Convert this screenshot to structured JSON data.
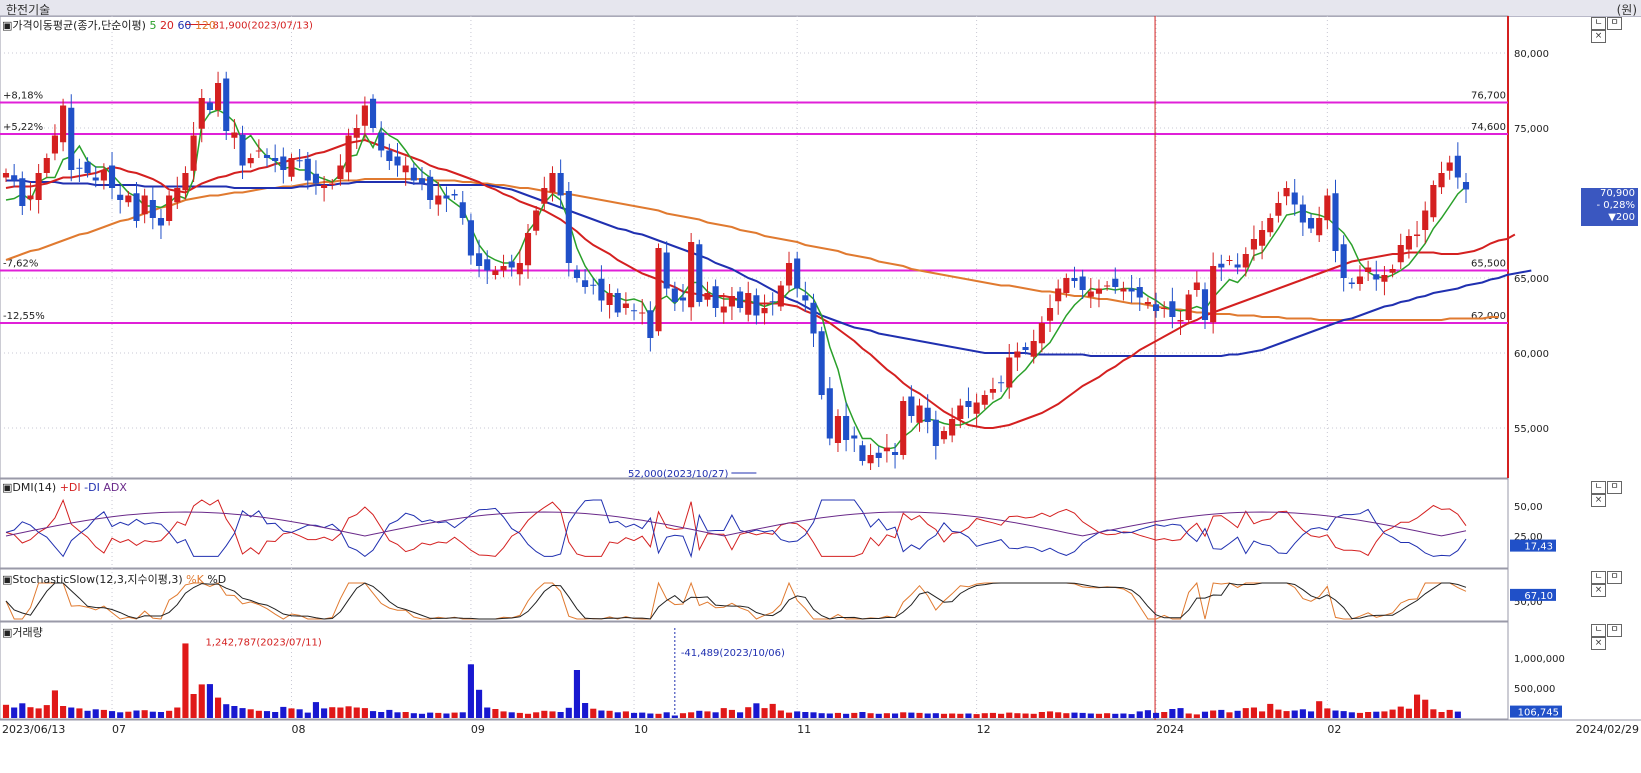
{
  "window": {
    "title": "한전기술",
    "unit_label": "(원)"
  },
  "panels": {
    "price": {
      "label_prefix": "가격이동평균(종가,단순이평)",
      "ma_labels": [
        "5",
        "20",
        "60",
        "120"
      ],
      "ma_colors": [
        "#2aa02a",
        "#d42020",
        "#2030b0",
        "#e07a30"
      ]
    },
    "dmi": {
      "label_prefix": "DMI(14)",
      "plus_di": "+DI",
      "minus_di": "-DI",
      "adx": "ADX",
      "value_label": "17,43"
    },
    "stoch": {
      "label_prefix": "StochasticSlow(12,3,지수이평,3)",
      "k": "%K",
      "d": "%D",
      "value_label": "67,10"
    },
    "volume": {
      "label_prefix": "거래량",
      "value_label": "106,745"
    }
  },
  "current_price": {
    "price": "70,900",
    "change_pct": "- 0,28%",
    "change": "▼200"
  },
  "controls": [
    "ㄴ",
    "ㅁ",
    "×"
  ],
  "chart_data": {
    "type": "candlestick",
    "title": "한전기술",
    "y_ticks": [
      "80,000",
      "75,000",
      "65,000",
      "60,000",
      "55,000"
    ],
    "y_range": [
      51800,
      82200
    ],
    "hlines": [
      {
        "price": 76700,
        "left_label": "+8,18%",
        "right_label": "76,700"
      },
      {
        "price": 74600,
        "left_label": "+5,22%",
        "right_label": "74,600"
      },
      {
        "price": 65500,
        "left_label": "-7,62%",
        "right_label": "65,500"
      },
      {
        "price": 62000,
        "left_label": "-12,55%",
        "right_label": "62,000"
      }
    ],
    "annotations": [
      {
        "text": "81,900(2023/07/13)",
        "price": 81900
      },
      {
        "text": "52,000(2023/10/27)",
        "price": 52000
      }
    ],
    "dates": [
      "2023/06/13",
      "2023/06/14",
      "2023/06/15",
      "2023/06/16",
      "2023/06/19",
      "2023/06/20",
      "2023/06/21",
      "2023/06/22",
      "2023/06/23",
      "2023/06/26",
      "2023/06/27",
      "2023/06/28",
      "2023/06/29",
      "2023/06/30",
      "2023/07/03",
      "2023/07/04",
      "2023/07/05",
      "2023/07/06",
      "2023/07/07",
      "2023/07/10",
      "2023/07/11",
      "2023/07/12",
      "2023/07/13",
      "2023/07/14",
      "2023/07/17",
      "2023/07/18",
      "2023/07/19",
      "2023/07/20",
      "2023/07/21",
      "2023/07/24",
      "2023/07/25",
      "2023/07/26",
      "2023/07/27",
      "2023/07/28",
      "2023/07/31",
      "2023/08/01",
      "2023/08/02",
      "2023/08/03",
      "2023/08/04",
      "2023/08/07",
      "2023/08/08",
      "2023/08/09",
      "2023/08/10",
      "2023/08/11",
      "2023/08/14",
      "2023/08/16",
      "2023/08/17",
      "2023/08/18",
      "2023/08/21",
      "2023/08/22",
      "2023/08/23",
      "2023/08/24",
      "2023/08/25",
      "2023/08/28",
      "2023/08/29",
      "2023/08/30",
      "2023/08/31",
      "2023/09/01",
      "2023/09/04",
      "2023/09/05",
      "2023/09/06",
      "2023/09/07",
      "2023/09/08",
      "2023/09/11",
      "2023/09/12",
      "2023/09/13",
      "2023/09/14",
      "2023/09/15",
      "2023/09/18",
      "2023/09/19",
      "2023/09/20",
      "2023/09/21",
      "2023/09/22",
      "2023/09/25",
      "2023/09/26",
      "2023/09/27",
      "2023/10/04",
      "2023/10/05",
      "2023/10/06",
      "2023/10/10",
      "2023/10/11",
      "2023/10/12",
      "2023/10/13",
      "2023/10/16",
      "2023/10/17",
      "2023/10/18",
      "2023/10/19",
      "2023/10/20",
      "2023/10/23",
      "2023/10/24",
      "2023/10/25",
      "2023/10/26",
      "2023/10/27",
      "2023/10/30",
      "2023/10/31",
      "2023/11/01",
      "2023/11/02",
      "2023/11/03",
      "2023/11/06",
      "2023/11/07",
      "2023/11/08",
      "2023/11/09",
      "2023/11/10",
      "2023/11/13",
      "2023/11/14",
      "2023/11/15",
      "2023/11/16",
      "2023/11/17",
      "2023/11/20",
      "2023/11/21",
      "2023/11/22",
      "2023/11/23",
      "2023/11/24",
      "2023/11/27",
      "2023/11/28",
      "2023/11/29",
      "2023/11/30",
      "2023/12/01",
      "2023/12/04",
      "2023/12/05",
      "2023/12/06",
      "2023/12/07",
      "2023/12/08",
      "2023/12/11",
      "2023/12/12",
      "2023/12/13",
      "2023/12/14",
      "2023/12/15",
      "2023/12/18",
      "2023/12/19",
      "2023/12/20",
      "2023/12/21",
      "2023/12/22",
      "2023/12/26",
      "2023/12/27",
      "2023/12/28",
      "2024/01/02",
      "2024/01/03",
      "2024/01/04",
      "2024/01/05",
      "2024/01/08",
      "2024/01/09",
      "2024/01/10",
      "2024/01/11",
      "2024/01/12",
      "2024/01/15",
      "2024/01/16",
      "2024/01/17",
      "2024/01/18",
      "2024/01/19",
      "2024/01/22",
      "2024/01/23",
      "2024/01/24",
      "2024/01/25",
      "2024/01/26",
      "2024/01/29",
      "2024/01/30",
      "2024/01/31",
      "2024/02/01",
      "2024/02/02",
      "2024/02/05",
      "2024/02/06",
      "2024/02/07",
      "2024/02/08",
      "2024/02/13",
      "2024/02/14",
      "2024/02/15",
      "2024/02/16",
      "2024/02/19",
      "2024/02/20",
      "2024/02/21",
      "2024/02/22",
      "2024/02/23",
      "2024/02/26",
      "2024/02/27",
      "2024/02/28",
      "2024/02/29"
    ],
    "close": [
      72000,
      71500,
      69800,
      70500,
      72000,
      73000,
      74500,
      76500,
      72200,
      72300,
      72000,
      71500,
      72200,
      71000,
      70200,
      70500,
      68800,
      70500,
      69000,
      68500,
      70500,
      71000,
      72000,
      74500,
      77000,
      76200,
      78000,
      74800,
      74700,
      72500,
      73000,
      73500,
      73000,
      72800,
      72200,
      73000,
      72800,
      71500,
      71300,
      71200,
      71300,
      72500,
      74500,
      75000,
      76500,
      75000,
      73500,
      72800,
      72500,
      72500,
      71500,
      71300,
      70200,
      70500,
      70300,
      70500,
      69000,
      66500,
      65800,
      65500,
      65500,
      65800,
      65700,
      66000,
      68000,
      69500,
      71000,
      72000,
      70500,
      66000,
      65000,
      64400,
      64500,
      63500,
      64000,
      62700,
      63300,
      62800,
      62700,
      61000,
      67000,
      64300,
      63400,
      63500,
      67400,
      63400,
      64000,
      63000,
      63100,
      63800,
      63000,
      64000,
      62500,
      63000,
      63400,
      64500,
      66000,
      64300,
      63500,
      61300,
      57200,
      54300,
      55800,
      54200,
      54300,
      52800,
      53200,
      53000,
      53700,
      53200,
      56800,
      55800,
      56500,
      55400,
      53800,
      54800,
      55600,
      56500,
      56400,
      56700,
      57200,
      57600,
      58000,
      59700,
      60100,
      60200,
      60800,
      62000,
      63000,
      64300,
      65000,
      64800,
      64200,
      64100,
      64300,
      64500,
      64400,
      64300,
      64100,
      63700,
      63400,
      62800,
      63000,
      62400,
      62200,
      63900,
      64700,
      62200,
      65800,
      65700,
      66200,
      65700,
      66600,
      67600,
      68200,
      69000,
      70000,
      71000,
      69900,
      68700,
      68300,
      69000,
      70500,
      66800,
      65000,
      64600,
      65100,
      65700,
      64900,
      65200,
      65600,
      67200,
      67800,
      67900,
      69500,
      71200,
      72000,
      72700,
      71700,
      70900
    ],
    "volume": [
      220000,
      175000,
      245000,
      180000,
      160000,
      215000,
      460000,
      200000,
      175000,
      160000,
      120000,
      145000,
      135000,
      115000,
      95000,
      105000,
      125000,
      130000,
      105000,
      100000,
      120000,
      175000,
      1242787,
      400000,
      560000,
      565000,
      340000,
      230000,
      200000,
      165000,
      145000,
      120000,
      115000,
      100000,
      185000,
      160000,
      145000,
      90000,
      265000,
      160000,
      180000,
      175000,
      195000,
      175000,
      165000,
      115000,
      100000,
      135000,
      95000,
      100000,
      80000,
      70000,
      90000,
      85000,
      75000,
      90000,
      95000,
      895000,
      470000,
      175000,
      150000,
      110000,
      95000,
      85000,
      70000,
      95000,
      120000,
      110000,
      100000,
      170000,
      800000,
      250000,
      155000,
      125000,
      120000,
      95000,
      110000,
      85000,
      90000,
      75000,
      70000,
      95000,
      41489,
      80000,
      95000,
      120000,
      110000,
      95000,
      165000,
      135000,
      95000,
      180000,
      245000,
      165000,
      235000,
      125000,
      90000,
      110000,
      100000,
      95000,
      80000,
      75000,
      85000,
      70000,
      85000,
      100000,
      80000,
      70000,
      80000,
      75000,
      95000,
      90000,
      85000,
      75000,
      80000,
      70000,
      75000,
      70000,
      75000,
      65000,
      80000,
      85000,
      70000,
      90000,
      80000,
      75000,
      70000,
      100000,
      110000,
      95000,
      80000,
      90000,
      85000,
      75000,
      70000,
      80000,
      70000,
      75000,
      65000,
      110000,
      130000,
      85000,
      100000,
      150000,
      165000,
      75000,
      60000,
      105000,
      125000,
      135000,
      95000,
      120000,
      165000,
      175000,
      110000,
      235000,
      140000,
      115000,
      125000,
      145000,
      110000,
      280000,
      160000,
      125000,
      115000,
      95000,
      85000,
      100000,
      105000,
      110000,
      140000,
      190000,
      155000,
      390000,
      305000,
      145000,
      100000,
      135000,
      106745
    ],
    "ma5": [
      70200,
      70300,
      70600,
      70200,
      71400,
      71700,
      71700,
      72900,
      73100,
      73800,
      72800,
      72400,
      72400,
      71900,
      71300,
      70700,
      70400,
      69800,
      69800,
      69700,
      70000,
      70500,
      70300,
      71600,
      75200,
      76000,
      76200,
      75900,
      75400,
      74100,
      74500,
      73700,
      73100,
      72800,
      72300,
      72400,
      72200,
      72200,
      71800,
      71600,
      71400,
      71900,
      73100,
      73200,
      74600,
      73700,
      75000,
      74500,
      74200,
      73500,
      72700,
      72100,
      71700,
      71300,
      70400,
      70000,
      69600,
      68400,
      67200,
      66500,
      66200,
      66000,
      66000,
      66800,
      68100,
      68800,
      70000,
      70600,
      70200,
      68800,
      67000,
      65800,
      65000,
      64300,
      63900,
      63700,
      63500,
      63600,
      63400,
      62400,
      63500,
      63800,
      63300,
      63900,
      64700,
      64700,
      64100,
      63800,
      63600,
      63600,
      63500,
      63500,
      63300,
      63100,
      63300,
      63500,
      64100,
      64400,
      64100,
      63600,
      62500,
      60400,
      58900,
      56700,
      55400,
      54300,
      54300,
      53800,
      53600,
      53700,
      54400,
      54800,
      55400,
      55600,
      55500,
      55300,
      55200,
      55200,
      55400,
      55700,
      56200,
      56700,
      57000,
      57800,
      58400,
      58900,
      59600,
      60200,
      60700,
      61600,
      62500,
      63200,
      63700,
      64300,
      64200,
      64300,
      64200,
      64300,
      64300,
      64200,
      63800,
      63500,
      63100,
      62900,
      62800,
      62900,
      63100,
      62900,
      63700,
      64300,
      64900,
      64700,
      65300,
      66500,
      66700,
      67500,
      68300,
      69200,
      69300,
      69500,
      69300,
      69200,
      69000,
      68500,
      68000,
      67200,
      66000,
      65400,
      65100,
      65000,
      65200,
      65500,
      65900,
      66600,
      67300,
      68300,
      69000,
      69800,
      70600,
      71100
    ],
    "ma20": [
      71000,
      71100,
      71100,
      71100,
      71200,
      71300,
      71500,
      71700,
      71700,
      71800,
      71900,
      72000,
      72200,
      72400,
      72300,
      72100,
      72000,
      71800,
      71600,
      71300,
      70900,
      70800,
      70700,
      71000,
      71300,
      71500,
      71700,
      71800,
      72000,
      72100,
      72100,
      72300,
      72400,
      72600,
      72700,
      72900,
      73000,
      73100,
      73300,
      73400,
      73600,
      73800,
      74000,
      74100,
      74200,
      74000,
      73800,
      73600,
      73400,
      73200,
      73000,
      72800,
      72500,
      72300,
      72200,
      72000,
      71800,
      71600,
      71400,
      71100,
      70900,
      70600,
      70400,
      70100,
      69900,
      69700,
      69500,
      69200,
      68900,
      68500,
      68100,
      67600,
      67200,
      66900,
      66600,
      66200,
      65900,
      65600,
      65300,
      65100,
      64900,
      64600,
      64400,
      64100,
      64000,
      63900,
      63800,
      63800,
      63800,
      63700,
      63500,
      63400,
      63300,
      63300,
      63300,
      63300,
      63200,
      63100,
      62800,
      62600,
      62300,
      62000,
      61600,
      61200,
      60800,
      60300,
      59900,
      59400,
      58900,
      58500,
      58000,
      57600,
      57300,
      56900,
      56500,
      56100,
      55800,
      55500,
      55200,
      55100,
      55000,
      55000,
      55100,
      55200,
      55400,
      55600,
      55800,
      56000,
      56300,
      56600,
      57000,
      57400,
      57800,
      58100,
      58400,
      58800,
      59100,
      59500,
      59800,
      60200,
      60500,
      60800,
      61100,
      61400,
      61700,
      62000,
      62200,
      62500,
      62700,
      62900,
      63100,
      63300,
      63500,
      63700,
      63900,
      64100,
      64300,
      64500,
      64700,
      64900,
      65100,
      65300,
      65500,
      65700,
      65900,
      66100,
      66200,
      66300,
      66400,
      66500,
      66600,
      66600,
      66700,
      66700,
      66700,
      66700,
      66600,
      66600,
      66600,
      66700,
      66800,
      67000,
      67300,
      67500,
      67600,
      67900
    ],
    "ma60": [
      71500,
      71500,
      71500,
      71400,
      71400,
      71400,
      71400,
      71300,
      71300,
      71300,
      71300,
      71200,
      71200,
      71200,
      71200,
      71200,
      71200,
      71100,
      71100,
      71100,
      71100,
      71100,
      71100,
      71100,
      71100,
      71100,
      71100,
      71100,
      71000,
      71000,
      71000,
      71000,
      71000,
      71000,
      71000,
      71000,
      71100,
      71100,
      71200,
      71200,
      71200,
      71300,
      71300,
      71400,
      71400,
      71400,
      71400,
      71400,
      71400,
      71400,
      71300,
      71300,
      71200,
      71200,
      71200,
      71200,
      71200,
      71200,
      71200,
      71200,
      71100,
      71000,
      70900,
      70700,
      70500,
      70300,
      70100,
      69900,
      69700,
      69500,
      69300,
      69100,
      68900,
      68700,
      68500,
      68300,
      68200,
      68000,
      67900,
      67700,
      67500,
      67300,
      67100,
      66900,
      66700,
      66500,
      66300,
      66000,
      65800,
      65600,
      65300,
      65000,
      64800,
      64500,
      64200,
      63900,
      63600,
      63400,
      63100,
      62800,
      62500,
      62300,
      62100,
      61900,
      61700,
      61600,
      61500,
      61300,
      61200,
      61100,
      61000,
      60900,
      60800,
      60700,
      60600,
      60500,
      60400,
      60300,
      60200,
      60100,
      60000,
      60000,
      60000,
      60000,
      60000,
      60000,
      59900,
      59900,
      59900,
      59900,
      59900,
      59900,
      59900,
      59800,
      59800,
      59800,
      59800,
      59800,
      59800,
      59800,
      59800,
      59800,
      59800,
      59800,
      59800,
      59800,
      59800,
      59800,
      59800,
      59800,
      59900,
      59900,
      60000,
      60100,
      60200,
      60400,
      60600,
      60800,
      61000,
      61200,
      61400,
      61600,
      61800,
      62000,
      62200,
      62300,
      62500,
      62700,
      62900,
      63100,
      63200,
      63400,
      63500,
      63700,
      63800,
      64000,
      64100,
      64200,
      64300,
      64500,
      64600,
      64700,
      64900,
      65000,
      65200,
      65300,
      65400,
      65500
    ],
    "ma120": [
      66200,
      66400,
      66600,
      66800,
      66900,
      67100,
      67300,
      67500,
      67700,
      67900,
      68000,
      68200,
      68400,
      68600,
      68800,
      68900,
      69100,
      69300,
      69500,
      69700,
      69800,
      70000,
      70200,
      70300,
      70400,
      70500,
      70500,
      70600,
      70700,
      70700,
      70800,
      70900,
      71000,
      71000,
      71100,
      71100,
      71200,
      71300,
      71300,
      71400,
      71400,
      71500,
      71500,
      71500,
      71600,
      71600,
      71600,
      71600,
      71600,
      71600,
      71600,
      71600,
      71500,
      71500,
      71500,
      71500,
      71400,
      71400,
      71300,
      71300,
      71200,
      71200,
      71100,
      71000,
      71000,
      70900,
      70800,
      70700,
      70600,
      70600,
      70500,
      70400,
      70300,
      70200,
      70100,
      70000,
      69900,
      69800,
      69700,
      69600,
      69500,
      69300,
      69200,
      69100,
      69000,
      68900,
      68700,
      68600,
      68500,
      68400,
      68200,
      68100,
      68000,
      67800,
      67700,
      67600,
      67500,
      67400,
      67200,
      67100,
      67000,
      66900,
      66800,
      66600,
      66500,
      66400,
      66300,
      66100,
      66000,
      65900,
      65800,
      65600,
      65500,
      65400,
      65300,
      65200,
      65100,
      65000,
      64900,
      64800,
      64700,
      64600,
      64500,
      64500,
      64400,
      64300,
      64200,
      64100,
      64100,
      64000,
      63900,
      63800,
      63800,
      63700,
      63600,
      63600,
      63500,
      63400,
      63300,
      63300,
      63200,
      63100,
      63000,
      62900,
      62900,
      62800,
      62700,
      62700,
      62600,
      62600,
      62600,
      62500,
      62500,
      62500,
      62400,
      62400,
      62400,
      62300,
      62300,
      62300,
      62300,
      62200,
      62200,
      62200,
      62200,
      62200,
      62200,
      62200,
      62200,
      62200,
      62200,
      62200,
      62200,
      62200,
      62200,
      62200,
      62200,
      62300,
      62300,
      62300,
      62300,
      62300,
      62400,
      62400
    ]
  },
  "x_axis": {
    "labels": [
      "2023/06/13",
      "07",
      "08",
      "09",
      "10",
      "11",
      "12",
      "2024",
      "02",
      "2024/02/29"
    ]
  }
}
